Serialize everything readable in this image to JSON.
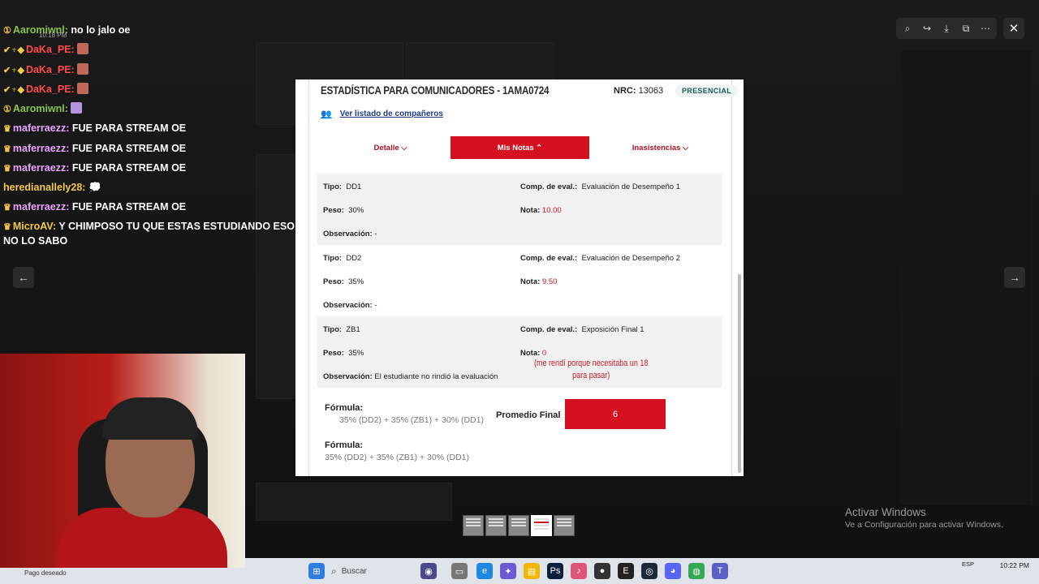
{
  "chat": {
    "timestamp": "10:18 PM",
    "messages": [
      {
        "user": "Aaromiwnl:",
        "color": "#8bc34a",
        "text": "no lo jalo oe",
        "badge": "①"
      },
      {
        "user": "DaKa_PE:",
        "color": "#ff4b4b",
        "text": "",
        "badge": "✔♆◆",
        "emote": "#c0685a"
      },
      {
        "user": "DaKa_PE:",
        "color": "#ff4b4b",
        "text": "",
        "badge": "✔♆◆",
        "emote": "#c0685a"
      },
      {
        "user": "DaKa_PE:",
        "color": "#ff4b4b",
        "text": "",
        "badge": "✔♆◆",
        "emote": "#c0685a"
      },
      {
        "user": "Aaromiwnl:",
        "color": "#8bc34a",
        "text": "",
        "badge": "①",
        "emote": "#b496e0"
      },
      {
        "user": "maferraezz:",
        "color": "#e8a6ff",
        "text": "FUE PARA STREAM OE",
        "badge": "♛"
      },
      {
        "user": "maferraezz:",
        "color": "#e8a6ff",
        "text": "FUE PARA STREAM OE",
        "badge": "♛"
      },
      {
        "user": "maferraezz:",
        "color": "#e8a6ff",
        "text": "FUE PARA STREAM OE",
        "badge": "♛"
      },
      {
        "user": "heredianallely28:",
        "color": "#f2c94c",
        "text": "💭",
        "badge": ""
      },
      {
        "user": "maferraezz:",
        "color": "#e8a6ff",
        "text": "FUE PARA STREAM OE",
        "badge": "♛"
      },
      {
        "user": "MicroAV:",
        "color": "#f2c94c",
        "text": "Y CHIMPOSO TU QUE ESTAS ESTUDIANDO ESO NO LO SABO",
        "badge": "♛"
      }
    ]
  },
  "viewer": {
    "tools": [
      "zoom-icon",
      "share-icon",
      "download-icon",
      "open-icon",
      "more-icon"
    ]
  },
  "doc": {
    "course_title": "ESTADÍSTICA PARA COMUNICADORES - 1AMA0724",
    "nrc_label": "NRC:",
    "nrc_value": "13063",
    "modality": "PRESENCIAL",
    "companions_link": "Ver listado de compañeros",
    "tabs": [
      {
        "label": "Detalle ⌵"
      },
      {
        "label": "Mis Notas ⌃"
      },
      {
        "label": "Inasistencias ⌵"
      }
    ],
    "labels": {
      "tipo": "Tipo:",
      "peso": "Peso:",
      "obs": "Observación:",
      "comp": "Comp. de eval.:",
      "nota": "Nota:"
    },
    "rows": [
      {
        "tipo": "DD1",
        "peso": "30%",
        "obs": "-",
        "comp": "Evaluación de Desempeño 1",
        "nota": "10.00"
      },
      {
        "tipo": "DD2",
        "peso": "35%",
        "obs": "-",
        "comp": "Evaluación de Desempeño 2",
        "nota": "9.50"
      },
      {
        "tipo": "ZB1",
        "peso": "35%",
        "obs": "El estudiante no rindió la evaluación",
        "comp": "Exposición Final 1",
        "nota": "0"
      }
    ],
    "handwritten_note_line1": "(me rendí porque necesitaba un 18",
    "handwritten_note_line2": "para pasar)",
    "formula_label": "Fórmula:",
    "formula_text": "35% (DD2) + 35% (ZB1) + 30% (DD1)",
    "promedio_label": "Promedio Final",
    "promedio_value": "6"
  },
  "watermark": {
    "line1": "Activar Windows",
    "line2": "Ve a Configuración para activar Windows."
  },
  "taskbar": {
    "search_placeholder": "Buscar",
    "lang": "ESP",
    "time": "10:22 PM",
    "status_left": "Pago deseado"
  }
}
